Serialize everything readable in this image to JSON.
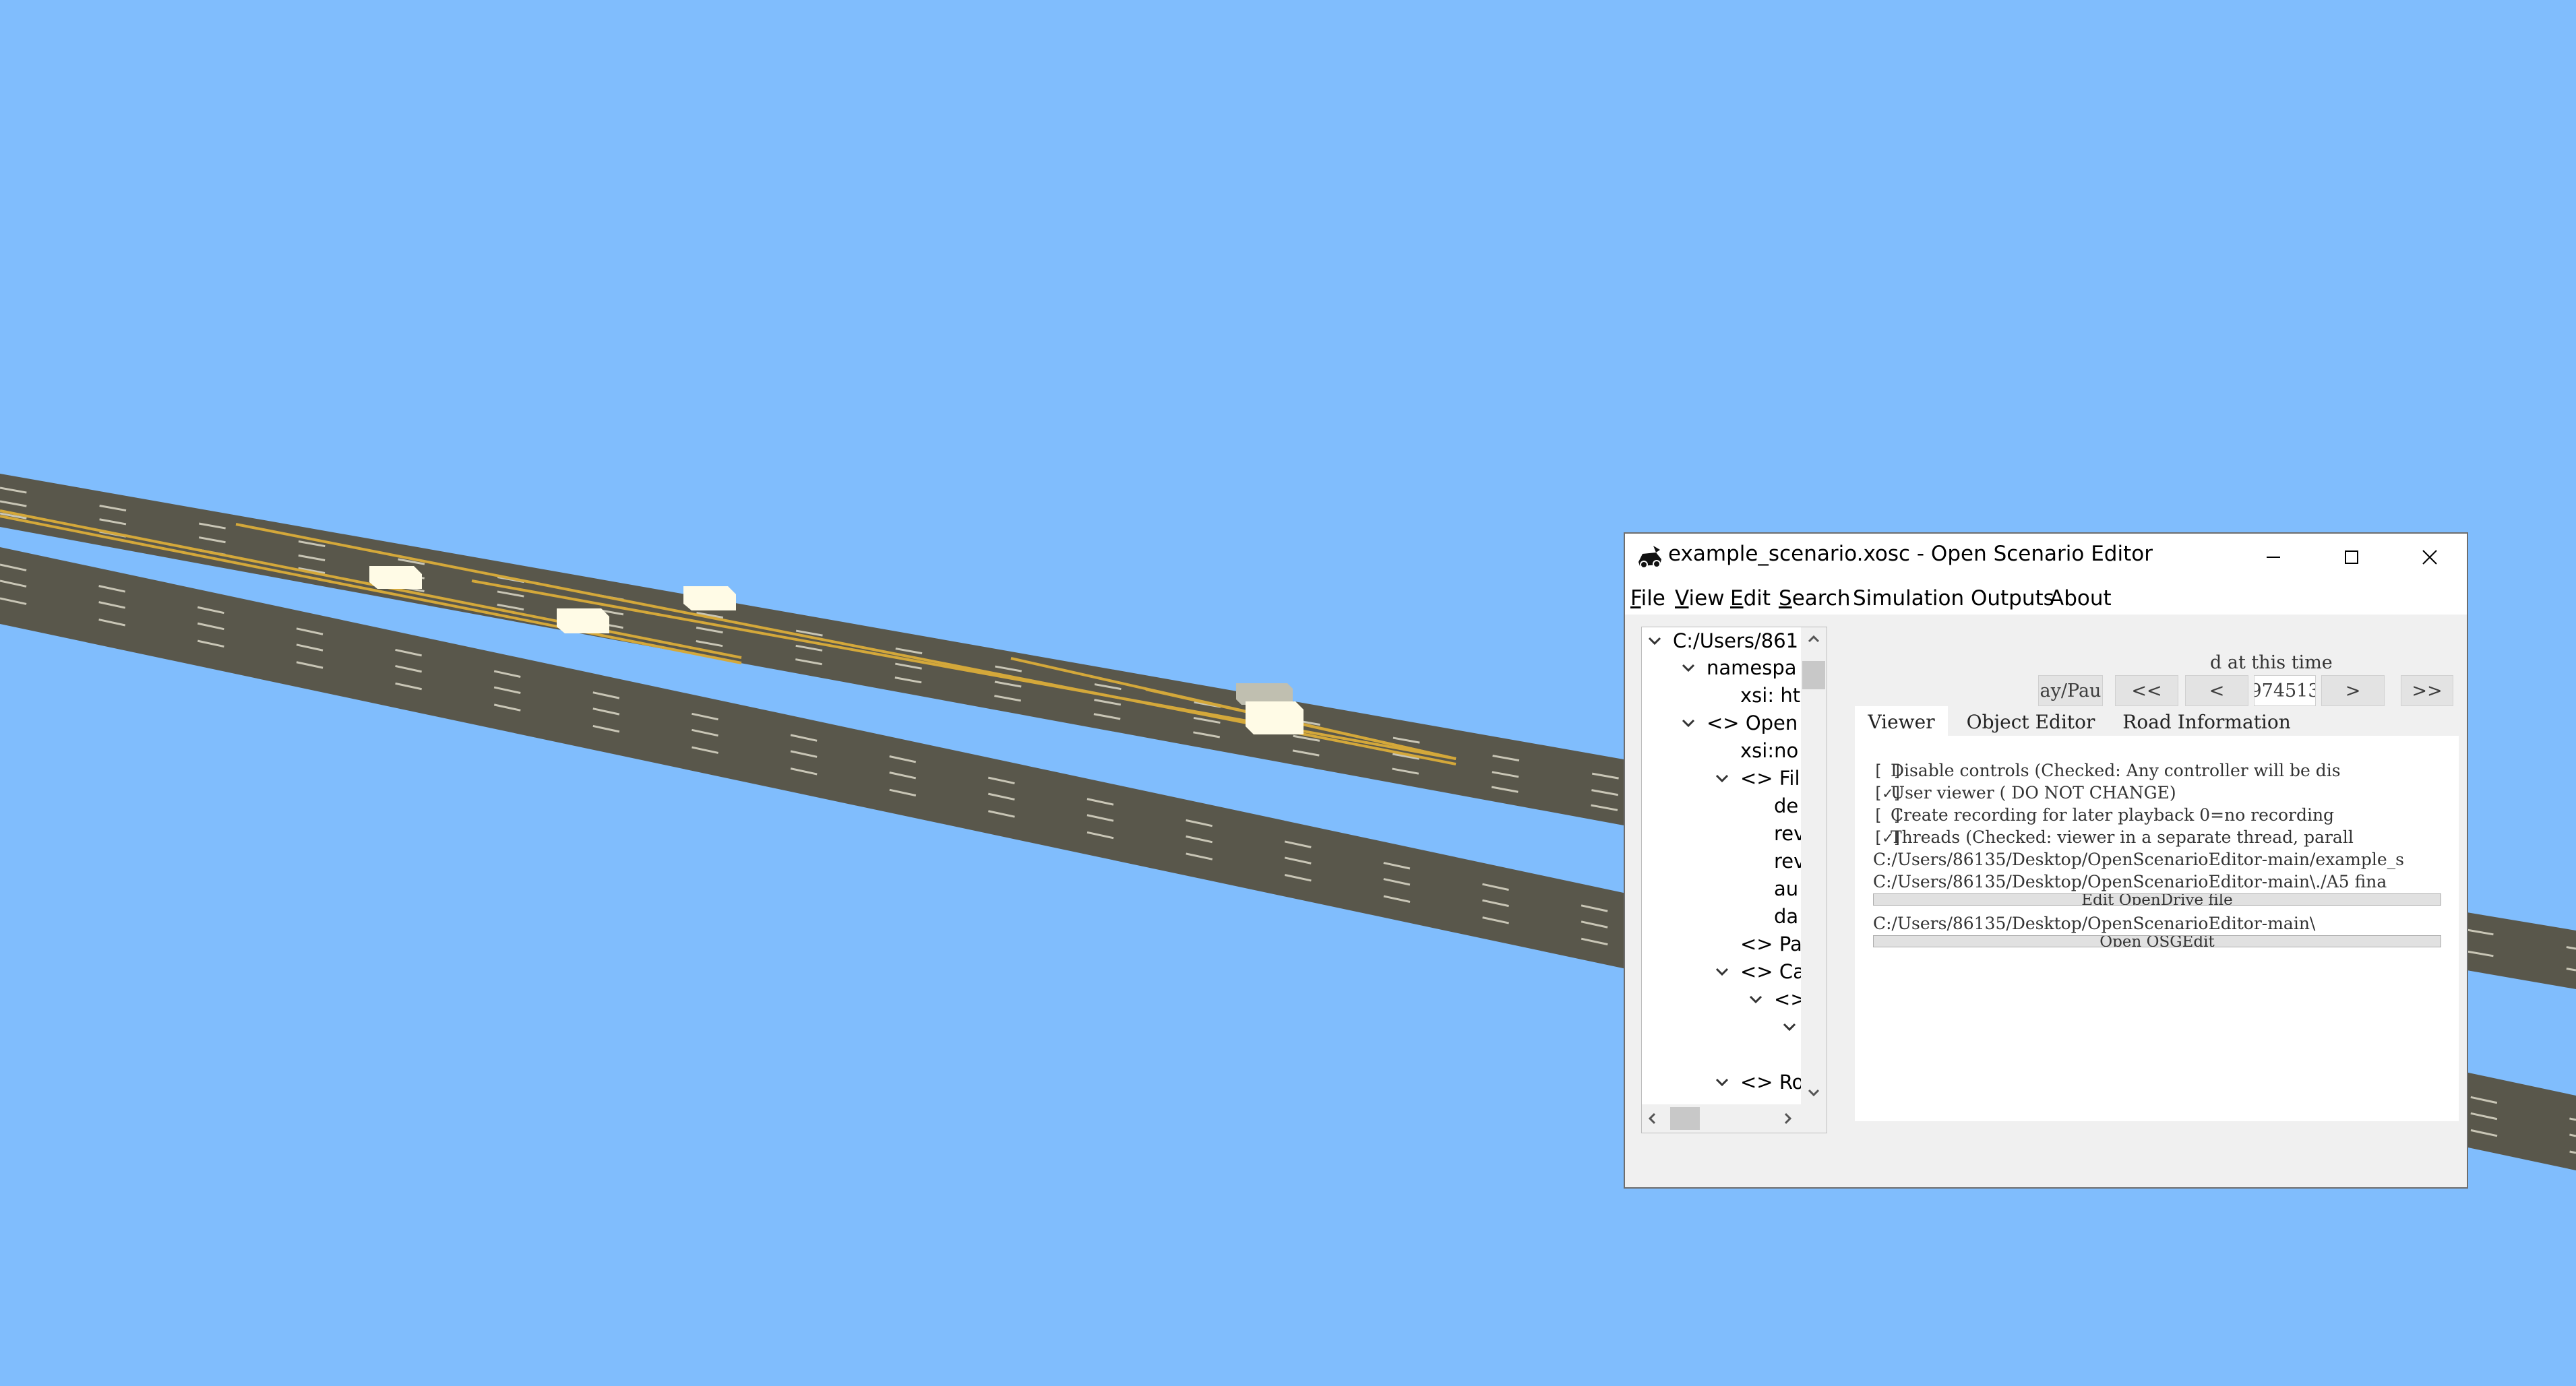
{
  "window": {
    "title": "example_scenario.xosc - Open Scenario Editor",
    "controls": [
      "minimize",
      "maximize",
      "close"
    ]
  },
  "menu": [
    {
      "mnemonic": "F",
      "rest": "ile"
    },
    {
      "mnemonic": "V",
      "rest": "iew"
    },
    {
      "mnemonic": "E",
      "rest": "dit"
    },
    {
      "mnemonic": "S",
      "rest": "earch"
    },
    {
      "mnemonic": "",
      "rest": "Simulation Outputs"
    },
    {
      "mnemonic": "",
      "rest": "About"
    }
  ],
  "tree": [
    {
      "label": "C:/Users/861",
      "expanded": true
    },
    {
      "label": "namespa",
      "expanded": true
    },
    {
      "label": "xsi: ht",
      "expanded": null
    },
    {
      "label": "<> Open",
      "expanded": true
    },
    {
      "label": "xsi:no",
      "expanded": null
    },
    {
      "label": "<> Fil",
      "expanded": true
    },
    {
      "label": "de",
      "expanded": null
    },
    {
      "label": "rev",
      "expanded": null
    },
    {
      "label": "rev",
      "expanded": null
    },
    {
      "label": "au",
      "expanded": null
    },
    {
      "label": "da",
      "expanded": null
    },
    {
      "label": "<> Pa",
      "expanded": null
    },
    {
      "label": "<> Ca",
      "expanded": true
    },
    {
      "label": "<>",
      "expanded": true
    },
    {
      "label": "",
      "expanded": true
    },
    {
      "label": "",
      "expanded": null
    },
    {
      "label": "<> Ro",
      "expanded": true
    },
    {
      "label": "<>",
      "expanded": true
    }
  ],
  "simulation": {
    "hint": "d at this time",
    "play_pause": "ay/Pau",
    "rewind": "<<",
    "step_back": "<",
    "time_value": "974513",
    "step_forward": ">",
    "fast_forward": ">>"
  },
  "tabs": [
    {
      "label": "Viewer",
      "active": true
    },
    {
      "label": "Object Editor",
      "active": false
    },
    {
      "label": "Road Information",
      "active": false
    }
  ],
  "viewer": {
    "options": [
      {
        "checked": false,
        "text": "Disable controls (Checked: Any controller will be dis"
      },
      {
        "checked": true,
        "text": "User viewer ( DO NOT CHANGE)"
      },
      {
        "checked": false,
        "text": "Create recording for later playback 0=no recording"
      },
      {
        "checked": true,
        "text": "Threads (Checked: viewer in a separate thread, parall"
      }
    ],
    "scenario_path": "C:/Users/86135/Desktop/OpenScenarioEditor-main/example_s",
    "road_path": "C:/Users/86135/Desktop/OpenScenarioEditor-main\\./A5 fina",
    "edit_road_button": "Edit OpenDrive file",
    "osg_path": "C:/Users/86135/Desktop/OpenScenarioEditor-main\\",
    "osg_button": "Open OSGEdit"
  },
  "colors": {
    "sky": "#80bdfd",
    "road": "#59574b",
    "lane_marking": "#c9c6b6",
    "center_line": "#d4a83a",
    "vehicle": "#fffbe6",
    "window_bg": "#f0f0f0"
  }
}
